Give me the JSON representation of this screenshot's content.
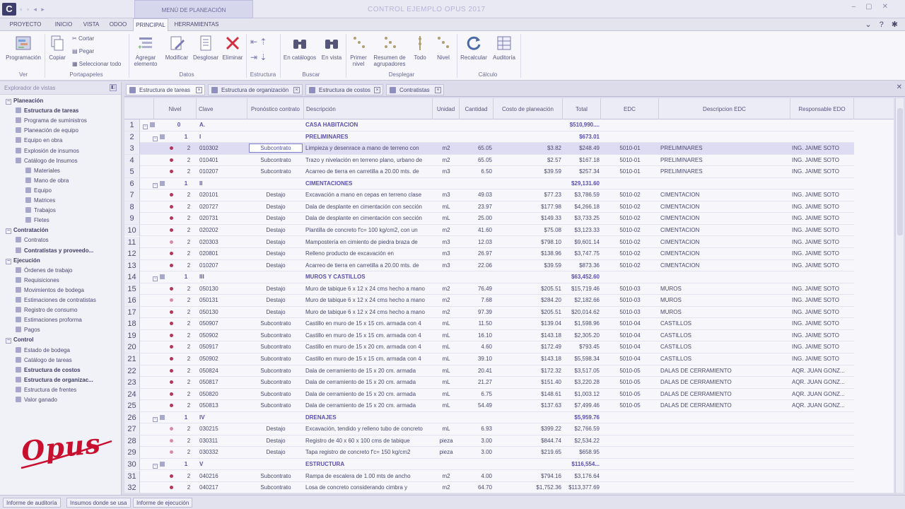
{
  "title_bar": {
    "context_title": "MENÚ DE PLANEACIÓN",
    "app_title": "CONTROL EJEMPLO OPUS 2017"
  },
  "menu": {
    "items": [
      "PROYECTO",
      "INICIO",
      "VISTA",
      "ODOO",
      "PRINCIPAL",
      "HERRAMIENTAS"
    ],
    "active": "PRINCIPAL"
  },
  "ribbon": {
    "buttons": {
      "programacion": "Programación",
      "copiar": "Copiar",
      "cortar": "Cortar",
      "pegar": "Pegar",
      "seleccionar_todo": "Seleccionar todo",
      "agregar_1": "Agregar",
      "agregar_2": "elemento",
      "modificar": "Modificar",
      "desglosar": "Desglosar",
      "eliminar": "Eliminar",
      "en_catalogos": "En catálogos",
      "en_vista": "En vista",
      "primer_1": "Primer",
      "primer_2": "nivel",
      "resumen_1": "Resumen de",
      "resumen_2": "agrupadores",
      "todo": "Todo",
      "nivel": "Nivel",
      "recalcular": "Recalcular",
      "auditoria": "Auditoría"
    },
    "groups": {
      "ver": "Ver",
      "portapapeles": "Portapapeles",
      "datos": "Datos",
      "estructura": "Estructura",
      "buscar": "Buscar",
      "desplegar": "Desplegar",
      "calculo": "Cálculo"
    }
  },
  "sidebar": {
    "header": "Explorador de vistas",
    "items": [
      {
        "label": "Planeación",
        "level": 0,
        "bold": true
      },
      {
        "label": "Estructura de tareas",
        "level": 1,
        "bold": true
      },
      {
        "label": "Programa de suministros",
        "level": 1,
        "bold": false
      },
      {
        "label": "Planeación de equipo",
        "level": 1,
        "bold": false
      },
      {
        "label": "Equipo en obra",
        "level": 1,
        "bold": false
      },
      {
        "label": "Explosión de insumos",
        "level": 1,
        "bold": false
      },
      {
        "label": "Catálogo de Insumos",
        "level": 1,
        "bold": false
      },
      {
        "label": "Materiales",
        "level": 2,
        "bold": false
      },
      {
        "label": "Mano de obra",
        "level": 2,
        "bold": false
      },
      {
        "label": "Equipo",
        "level": 2,
        "bold": false
      },
      {
        "label": "Matrices",
        "level": 2,
        "bold": false
      },
      {
        "label": "Trabajos",
        "level": 2,
        "bold": false
      },
      {
        "label": "Fletes",
        "level": 2,
        "bold": false
      },
      {
        "label": "Contratación",
        "level": 0,
        "bold": true
      },
      {
        "label": "Contratos",
        "level": 1,
        "bold": false
      },
      {
        "label": "Contratistas y proveedo...",
        "level": 1,
        "bold": true
      },
      {
        "label": "Ejecución",
        "level": 0,
        "bold": true
      },
      {
        "label": "Órdenes de trabajo",
        "level": 1,
        "bold": false
      },
      {
        "label": "Requisiciones",
        "level": 1,
        "bold": false
      },
      {
        "label": "Movimientos de bodega",
        "level": 1,
        "bold": false
      },
      {
        "label": "Estimaciones de contratistas",
        "level": 1,
        "bold": false
      },
      {
        "label": "Registro de consumo",
        "level": 1,
        "bold": false
      },
      {
        "label": "Estimaciones proforma",
        "level": 1,
        "bold": false
      },
      {
        "label": "Pagos",
        "level": 1,
        "bold": false
      },
      {
        "label": "Control",
        "level": 0,
        "bold": true
      },
      {
        "label": "Estado de bodega",
        "level": 1,
        "bold": false
      },
      {
        "label": "Catálogo de tareas",
        "level": 1,
        "bold": false
      },
      {
        "label": "Estructura de costos",
        "level": 1,
        "bold": true
      },
      {
        "label": "Estructura de organizac...",
        "level": 1,
        "bold": true
      },
      {
        "label": "Estructura de frentes",
        "level": 1,
        "bold": false
      },
      {
        "label": "Valor ganado",
        "level": 1,
        "bold": false
      }
    ],
    "logo_text": "Opus"
  },
  "doc_tabs": [
    "Estructura de tareas",
    "Estructura de organización",
    "Estructura de costos",
    "Contratistas"
  ],
  "grid": {
    "columns": [
      "Nivel",
      "Clave",
      "Pronóstico contrato",
      "Descripción",
      "Unidad",
      "Cantidad",
      "Costo de planeación",
      "Total",
      "EDC",
      "Descripcion EDC",
      "Responsable EDO"
    ],
    "rows": [
      {
        "n": "1",
        "lvl": "0",
        "clave": "A.",
        "pron": "",
        "desc": "CASA HABITACION",
        "unidad": "",
        "cant": "",
        "costo": "",
        "total": "$510,990....",
        "edc": "",
        "desc_edc": "",
        "resp": "",
        "group": true
      },
      {
        "n": "2",
        "lvl": "1",
        "clave": "I",
        "pron": "",
        "desc": "PRELIMINARES",
        "unidad": "",
        "cant": "",
        "costo": "",
        "total": "$673.01",
        "edc": "",
        "desc_edc": "",
        "resp": "",
        "group": true
      },
      {
        "n": "3",
        "lvl": "2",
        "clave": "010302",
        "pron": "Subcontrato",
        "desc": "Limpieza y desenrace a mano de terreno con",
        "unidad": "m2",
        "cant": "65.05",
        "costo": "$3.82",
        "total": "$248.49",
        "edc": "5010-01",
        "desc_edc": "PRELIMINARES",
        "resp": "ING. JAIME SOTO",
        "selected": true
      },
      {
        "n": "4",
        "lvl": "2",
        "clave": "010401",
        "pron": "Subcontrato",
        "desc": "Trazo y nivelación en terreno plano, urbano de",
        "unidad": "m2",
        "cant": "65.05",
        "costo": "$2.57",
        "total": "$167.18",
        "edc": "5010-01",
        "desc_edc": "PRELIMINARES",
        "resp": "ING. JAIME SOTO"
      },
      {
        "n": "5",
        "lvl": "2",
        "clave": "010207",
        "pron": "Subcontrato",
        "desc": "Acarreo de tierra en carretilla a 20.00 mts. de",
        "unidad": "m3",
        "cant": "6.50",
        "costo": "$39.59",
        "total": "$257.34",
        "edc": "5010-01",
        "desc_edc": "PRELIMINARES",
        "resp": "ING. JAIME SOTO"
      },
      {
        "n": "6",
        "lvl": "1",
        "clave": "II",
        "pron": "",
        "desc": "CIMENTACIONES",
        "unidad": "",
        "cant": "",
        "costo": "",
        "total": "$29,131.60",
        "edc": "",
        "desc_edc": "",
        "resp": "",
        "group": true
      },
      {
        "n": "7",
        "lvl": "2",
        "clave": "020101",
        "pron": "Destajo",
        "desc": "Excavación a mano en cepas en terreno clase",
        "unidad": "m3",
        "cant": "49.03",
        "costo": "$77.23",
        "total": "$3,786.59",
        "edc": "5010-02",
        "desc_edc": "CIMENTACION",
        "resp": "ING. JAIME SOTO"
      },
      {
        "n": "8",
        "lvl": "2",
        "clave": "020727",
        "pron": "Destajo",
        "desc": "Dala de desplante en cimentación con sección",
        "unidad": "mL",
        "cant": "23.97",
        "costo": "$177.98",
        "total": "$4,266.18",
        "edc": "5010-02",
        "desc_edc": "CIMENTACION",
        "resp": "ING. JAIME SOTO"
      },
      {
        "n": "9",
        "lvl": "2",
        "clave": "020731",
        "pron": "Destajo",
        "desc": "Dala de desplante en cimentación con sección",
        "unidad": "mL",
        "cant": "25.00",
        "costo": "$149.33",
        "total": "$3,733.25",
        "edc": "5010-02",
        "desc_edc": "CIMENTACION",
        "resp": "ING. JAIME SOTO"
      },
      {
        "n": "10",
        "lvl": "2",
        "clave": "020202",
        "pron": "Destajo",
        "desc": "Plantilla de concreto f'c= 100 kg/cm2, con un",
        "unidad": "m2",
        "cant": "41.60",
        "costo": "$75.08",
        "total": "$3,123.33",
        "edc": "5010-02",
        "desc_edc": "CIMENTACION",
        "resp": "ING. JAIME SOTO"
      },
      {
        "n": "11",
        "lvl": "2",
        "clave": "020303",
        "pron": "Destajo",
        "desc": "Mampostería en cimiento de piedra braza de",
        "unidad": "m3",
        "cant": "12.03",
        "costo": "$798.10",
        "total": "$9,601.14",
        "edc": "5010-02",
        "desc_edc": "CIMENTACION",
        "resp": "ING. JAIME SOTO"
      },
      {
        "n": "12",
        "lvl": "2",
        "clave": "020801",
        "pron": "Destajo",
        "desc": "Relleno producto de excavación en",
        "unidad": "m3",
        "cant": "26.97",
        "costo": "$138.96",
        "total": "$3,747.75",
        "edc": "5010-02",
        "desc_edc": "CIMENTACION",
        "resp": "ING. JAIME SOTO"
      },
      {
        "n": "13",
        "lvl": "2",
        "clave": "010207",
        "pron": "Destajo",
        "desc": "Acarreo de tierra en carretilla a 20.00 mts. de",
        "unidad": "m3",
        "cant": "22.06",
        "costo": "$39.59",
        "total": "$873.36",
        "edc": "5010-02",
        "desc_edc": "CIMENTACION",
        "resp": "ING. JAIME SOTO"
      },
      {
        "n": "14",
        "lvl": "1",
        "clave": "III",
        "pron": "",
        "desc": "MUROS Y CASTILLOS",
        "unidad": "",
        "cant": "",
        "costo": "",
        "total": "$63,452.60",
        "edc": "",
        "desc_edc": "",
        "resp": "",
        "group": true
      },
      {
        "n": "15",
        "lvl": "2",
        "clave": "050130",
        "pron": "Destajo",
        "desc": "Muro de tabique 6 x 12 x 24 cms hecho a mano",
        "unidad": "m2",
        "cant": "76.49",
        "costo": "$205.51",
        "total": "$15,719.46",
        "edc": "5010-03",
        "desc_edc": "MUROS",
        "resp": "ING. JAIME SOTO"
      },
      {
        "n": "16",
        "lvl": "2",
        "clave": "050131",
        "pron": "Destajo",
        "desc": "Muro de tabique 6 x 12 x 24 cms hecho a mano",
        "unidad": "m2",
        "cant": "7.68",
        "costo": "$284.20",
        "total": "$2,182.66",
        "edc": "5010-03",
        "desc_edc": "MUROS",
        "resp": "ING. JAIME SOTO"
      },
      {
        "n": "17",
        "lvl": "2",
        "clave": "050130",
        "pron": "Destajo",
        "desc": "Muro de tabique 6 x 12 x 24 cms hecho a mano",
        "unidad": "m2",
        "cant": "97.39",
        "costo": "$205.51",
        "total": "$20,014.62",
        "edc": "5010-03",
        "desc_edc": "MUROS",
        "resp": "ING. JAIME SOTO"
      },
      {
        "n": "18",
        "lvl": "2",
        "clave": "050907",
        "pron": "Subcontrato",
        "desc": "Castillo en muro de 15 x 15 cm. armada con 4",
        "unidad": "mL",
        "cant": "11.50",
        "costo": "$139.04",
        "total": "$1,598.96",
        "edc": "5010-04",
        "desc_edc": "CASTILLOS",
        "resp": "ING. JAIME SOTO"
      },
      {
        "n": "19",
        "lvl": "2",
        "clave": "050902",
        "pron": "Subcontrato",
        "desc": "Castillo en muro de 15 x 15 cm. armada con 4",
        "unidad": "mL",
        "cant": "16.10",
        "costo": "$143.18",
        "total": "$2,305.20",
        "edc": "5010-04",
        "desc_edc": "CASTILLOS",
        "resp": "ING. JAIME SOTO"
      },
      {
        "n": "20",
        "lvl": "2",
        "clave": "050917",
        "pron": "Subcontrato",
        "desc": "Castillo en muro de 15 x 20 cm. armada con 4",
        "unidad": "mL",
        "cant": "4.60",
        "costo": "$172.49",
        "total": "$793.45",
        "edc": "5010-04",
        "desc_edc": "CASTILLOS",
        "resp": "ING. JAIME SOTO"
      },
      {
        "n": "21",
        "lvl": "2",
        "clave": "050902",
        "pron": "Subcontrato",
        "desc": "Castillo en muro de 15 x 15 cm. armada con 4",
        "unidad": "mL",
        "cant": "39.10",
        "costo": "$143.18",
        "total": "$5,598.34",
        "edc": "5010-04",
        "desc_edc": "CASTILLOS",
        "resp": "ING. JAIME SOTO"
      },
      {
        "n": "22",
        "lvl": "2",
        "clave": "050824",
        "pron": "Subcontrato",
        "desc": "Dala de cerramiento de 15 x 20 cm. armada",
        "unidad": "mL",
        "cant": "20.41",
        "costo": "$172.32",
        "total": "$3,517.05",
        "edc": "5010-05",
        "desc_edc": "DALAS DE CERRAMIENTO",
        "resp": "AQR. JUAN GONZ..."
      },
      {
        "n": "23",
        "lvl": "2",
        "clave": "050817",
        "pron": "Subcontrato",
        "desc": "Dala de cerramiento de 15 x 20 cm. armada",
        "unidad": "mL",
        "cant": "21.27",
        "costo": "$151.40",
        "total": "$3,220.28",
        "edc": "5010-05",
        "desc_edc": "DALAS DE CERRAMIENTO",
        "resp": "AQR. JUAN GONZ..."
      },
      {
        "n": "24",
        "lvl": "2",
        "clave": "050820",
        "pron": "Subcontrato",
        "desc": "Dala de cerramiento de 15 x 20 cm. armada",
        "unidad": "mL",
        "cant": "6.75",
        "costo": "$148.61",
        "total": "$1,003.12",
        "edc": "5010-05",
        "desc_edc": "DALAS DE CERRAMIENTO",
        "resp": "AQR. JUAN GONZ..."
      },
      {
        "n": "25",
        "lvl": "2",
        "clave": "050813",
        "pron": "Subcontrato",
        "desc": "Dala de cerramiento de 15 x 20 cm. armada",
        "unidad": "mL",
        "cant": "54.49",
        "costo": "$137.63",
        "total": "$7,499.46",
        "edc": "5010-05",
        "desc_edc": "DALAS DE CERRAMIENTO",
        "resp": "AQR. JUAN GONZ..."
      },
      {
        "n": "26",
        "lvl": "1",
        "clave": "IV",
        "pron": "",
        "desc": "DRENAJES",
        "unidad": "",
        "cant": "",
        "costo": "",
        "total": "$5,959.76",
        "edc": "",
        "desc_edc": "",
        "resp": "",
        "group": true
      },
      {
        "n": "27",
        "lvl": "2",
        "clave": "030215",
        "pron": "Destajo",
        "desc": "Excavación, tendido y relleno tubo de concreto",
        "unidad": "mL",
        "cant": "6.93",
        "costo": "$399.22",
        "total": "$2,766.59",
        "edc": "",
        "desc_edc": "",
        "resp": ""
      },
      {
        "n": "28",
        "lvl": "2",
        "clave": "030311",
        "pron": "Destajo",
        "desc": "Registro de 40 x 60 x 100 cms de tabique",
        "unidad": "pieza",
        "cant": "3.00",
        "costo": "$844.74",
        "total": "$2,534.22",
        "edc": "",
        "desc_edc": "",
        "resp": ""
      },
      {
        "n": "29",
        "lvl": "2",
        "clave": "030332",
        "pron": "Destajo",
        "desc": "Tapa registro de concreto f'c= 150 kg/cm2",
        "unidad": "pieza",
        "cant": "3.00",
        "costo": "$219.65",
        "total": "$658.95",
        "edc": "",
        "desc_edc": "",
        "resp": ""
      },
      {
        "n": "30",
        "lvl": "1",
        "clave": "V",
        "pron": "",
        "desc": "ESTRUCTURA",
        "unidad": "",
        "cant": "",
        "costo": "",
        "total": "$116,554...",
        "edc": "",
        "desc_edc": "",
        "resp": "",
        "group": true
      },
      {
        "n": "31",
        "lvl": "2",
        "clave": "040216",
        "pron": "Subcontrato",
        "desc": "Rampa de escalera de 1.00 mts de ancho",
        "unidad": "m2",
        "cant": "4.00",
        "costo": "$794.16",
        "total": "$3,176.64",
        "edc": "",
        "desc_edc": "",
        "resp": ""
      },
      {
        "n": "32",
        "lvl": "2",
        "clave": "040217",
        "pron": "Subcontrato",
        "desc": "Losa de concreto considerando cimbra y",
        "unidad": "m2",
        "cant": "64.70",
        "costo": "$1,752.36",
        "total": "$113,377.69",
        "edc": "",
        "desc_edc": "",
        "resp": ""
      }
    ]
  },
  "status_bar": [
    "Informe de auditoría",
    "Insumos donde se usa",
    "Informe de ejecución"
  ],
  "colors": {
    "accent": "#5b4fb0",
    "logo_red": "#c8102e",
    "selection": "#dedcf2"
  }
}
